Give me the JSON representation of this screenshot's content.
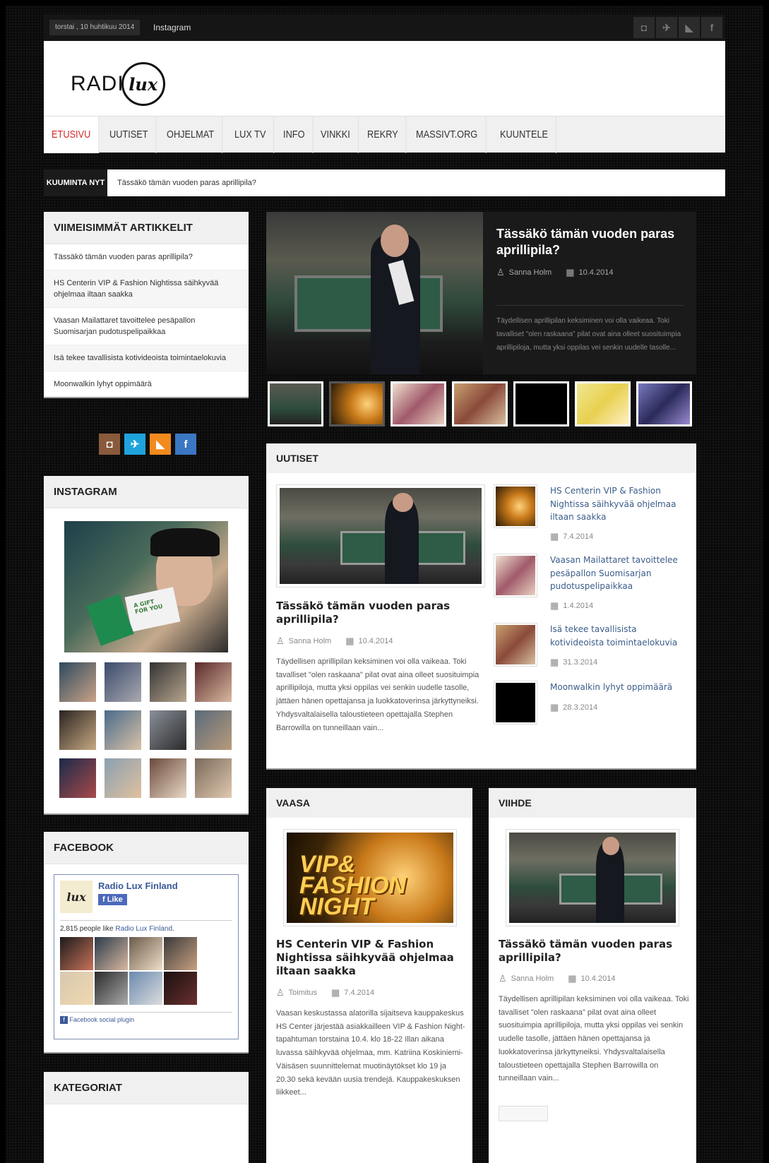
{
  "topbar": {
    "date": "torstai , 10 huhtikuu 2014",
    "link": "Instagram",
    "social": [
      "instagram-icon",
      "twitter-icon",
      "rss-icon",
      "facebook-icon"
    ]
  },
  "header": {
    "logo_text": "RADI",
    "logo_script": "lux"
  },
  "nav": {
    "items": [
      "ETUSIVU",
      "UUTISET",
      "OHJELMAT",
      "LUX TV",
      "INFO",
      "VINKKI",
      "REKRY",
      "MASSIVT.ORG",
      "KUUNTELE"
    ],
    "active": "ETUSIVU"
  },
  "ticker": {
    "label": "KUUMINTA NYT",
    "text": "Tässäkö tämän vuoden paras aprillipila?"
  },
  "sidebar": {
    "latest": {
      "title": "VIIMEISIMMÄT ARTIKKELIT",
      "items": [
        "Tässäkö tämän vuoden paras aprillipila?",
        "HS Centerin VIP & Fashion Nightissa säihkyvää ohjelmaa iltaan saakka",
        "Vaasan Mailattaret tavoittelee pesäpallon Suomisarjan pudotuspelipaikkaa",
        "Isä tekee tavallisista kotivideoista toimintaelokuvia",
        "Moonwalkin lyhyt oppimäärä"
      ]
    },
    "instagram": {
      "title": "INSTAGRAM",
      "card_text": "A GIFT FOR YOU"
    },
    "facebook": {
      "title": "FACEBOOK",
      "page_name": "Radio Lux Finland",
      "like_label": "Like",
      "count_prefix": "2,815 people like ",
      "count_link": "Radio Lux Finland",
      "count_suffix": ".",
      "plugin_label": "Facebook social plugin"
    },
    "categories": {
      "title": "KATEGORIAT"
    }
  },
  "featured": {
    "title": "Tässäkö tämän vuoden paras aprillipila?",
    "author": "Sanna Holm",
    "date": "10.4.2014",
    "excerpt": "Täydellisen aprillipilan keksiminen voi olla vaikeaa. Toki tavalliset \"olen raskaana\" pilat ovat aina olleet suosituimpia aprillipiloja, mutta yksi oppilas vei senkin uudelle tasolle..."
  },
  "uutiset": {
    "title": "UUTISET",
    "main": {
      "title": "Tässäkö tämän vuoden paras aprillipila?",
      "author": "Sanna Holm",
      "date": "10.4.2014",
      "excerpt": "Täydellisen aprillipilan keksiminen voi olla vaikeaa. Toki tavalliset \"olen raskaana\" pilat ovat aina olleet suosituimpia aprillipiloja, mutta yksi oppilas vei senkin uudelle tasolle, jättäen hänen opettajansa ja luokkatoverinsa järkyttyneiksi.  Yhdysvaltalaisella taloustieteen opettajalla Stephen Barrowilla on tunneillaan vain..."
    },
    "side": [
      {
        "title": "HS Centerin VIP & Fashion Nightissa säihkyvää ohjelmaa iltaan saakka",
        "date": "7.4.2014"
      },
      {
        "title": "Vaasan Mailattaret tavoittelee pesäpallon Suomisarjan pudotuspelipaikkaa",
        "date": "1.4.2014"
      },
      {
        "title": "Isä tekee tavallisista kotivideoista toimintaelokuvia",
        "date": "31.3.2014"
      },
      {
        "title": "Moonwalkin lyhyt oppimäärä",
        "date": "28.3.2014"
      }
    ]
  },
  "vaasa": {
    "title": "VAASA",
    "image_text": "VIP& FASHION NIGHT",
    "article_title": "HS Centerin VIP & Fashion Nightissa säihkyvää ohjelmaa iltaan saakka",
    "author": "Toimitus",
    "date": "7.4.2014",
    "excerpt": "Vaasan keskustassa alatorilla sijaitseva kauppakeskus HS Center järjestää asiakkailleen VIP & Fashion Night-tapahtuman torstaina 10.4. klo 18-22 Illan aikana luvassa säihkyvää ohjelmaa, mm. Katriina Koskiniemi-Väisäsen suunnittelemat muotinäytökset klo 19 ja 20.30 sekä kevään uusia trendejä. Kauppakeskuksen liikkeet..."
  },
  "viihde": {
    "title": "VIIHDE",
    "article_title": "Tässäkö tämän vuoden paras aprillipila?",
    "author": "Sanna Holm",
    "date": "10.4.2014",
    "excerpt": "Täydellisen aprillipilan keksiminen voi olla vaikeaa. Toki tavalliset \"olen raskaana\" pilat ovat aina olleet suosituimpia aprillipiloja, mutta yksi oppilas vei senkin uudelle tasolle, jättäen hänen opettajansa ja luokkatoverinsa järkyttyneiksi. Yhdysvaltalaisella taloustieteen opettajalla Stephen Barrowilla on tunneillaan vain..."
  },
  "colors": {
    "accent": "#d62828",
    "link": "#3b5c8a",
    "facebook": "#3b5998"
  }
}
